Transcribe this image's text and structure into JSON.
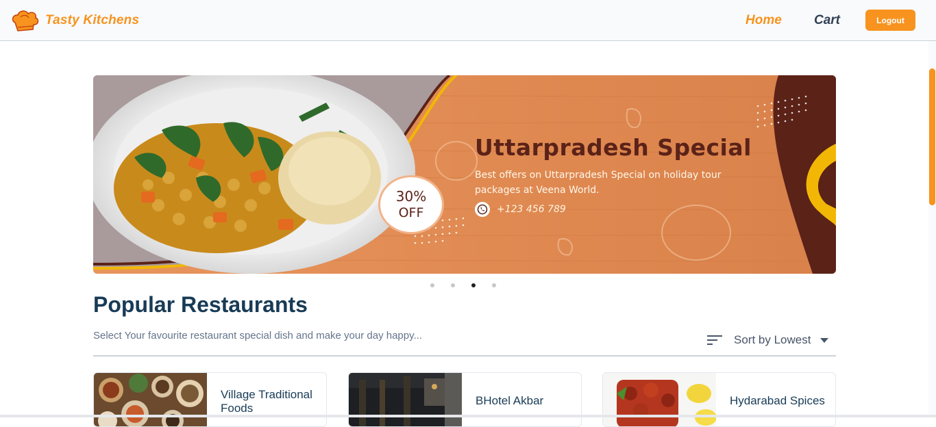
{
  "header": {
    "brand": "Tasty Kitchens",
    "nav": {
      "home": "Home",
      "cart": "Cart"
    },
    "logout_label": "Logout",
    "accent_color": "#f7931e"
  },
  "banner": {
    "discount_percent": "30%",
    "discount_off": "OFF",
    "title": "Uttarpradesh Special",
    "description": "Best offers on Uttarpradesh Special on holiday tour packages at Veena World.",
    "phone": "+123 456 789",
    "phone_icon": "whatsapp-icon",
    "carousel_active_index": 2,
    "carousel_count": 4
  },
  "section": {
    "title": "Popular Restaurants",
    "subtitle": "Select Your favourite restaurant special dish and make your day happy...",
    "sort_label": "Sort by Lowest",
    "sort_icon": "sort-lines-icon"
  },
  "restaurants": [
    {
      "name": "Village Traditional Foods"
    },
    {
      "name": "BHotel Akbar"
    },
    {
      "name": "Hydarabad Spices"
    }
  ]
}
